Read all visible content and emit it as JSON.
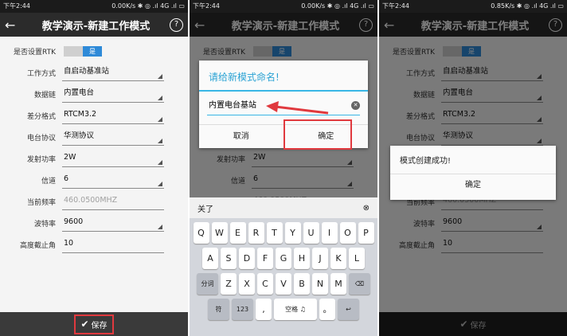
{
  "status": {
    "time": "下午2:44",
    "speed_p1": "0.00K/s",
    "speed_p2": "0.00K/s",
    "speed_p3": "0.85K/s",
    "indicators": "✱ ◎ .ıl 4G .ıl ▭"
  },
  "header": {
    "back": "←",
    "title": "教学演示-新建工作模式",
    "help": "?"
  },
  "form": {
    "rtk_label": "是否设置RTK",
    "rtk_state": "是",
    "rows": [
      {
        "label": "工作方式",
        "value": "自启动基准站"
      },
      {
        "label": "数据链",
        "value": "内置电台"
      },
      {
        "label": "差分格式",
        "value": "RTCM3.2"
      },
      {
        "label": "电台协议",
        "value": "华测协议"
      },
      {
        "label": "发射功率",
        "value": "2W"
      },
      {
        "label": "信道",
        "value": "6"
      },
      {
        "label": "当前频率",
        "value": "460.0500MHZ"
      },
      {
        "label": "波特率",
        "value": "9600"
      },
      {
        "label": "高度截止角",
        "value": "10"
      }
    ]
  },
  "save": {
    "icon": "✔",
    "label": "保存"
  },
  "name_dialog": {
    "title": "请给新模式命名!",
    "input_value": "内置电台基站",
    "clear": "✕",
    "cancel": "取消",
    "confirm": "确定"
  },
  "keyboard": {
    "close": "关了",
    "close_icon": "⊗",
    "row1": [
      "Q",
      "W",
      "E",
      "R",
      "T",
      "Y",
      "U",
      "I",
      "O",
      "P"
    ],
    "row2": [
      "A",
      "S",
      "D",
      "F",
      "G",
      "H",
      "J",
      "K",
      "L"
    ],
    "row3_left": "分词",
    "row3": [
      "Z",
      "X",
      "C",
      "V",
      "B",
      "N",
      "M"
    ],
    "row3_right": "⌫",
    "row4": [
      "符",
      "123",
      ",",
      "空格 ♫",
      "。",
      "↩"
    ]
  },
  "success_dialog": {
    "message": "模式创建成功!",
    "confirm": "确定"
  }
}
